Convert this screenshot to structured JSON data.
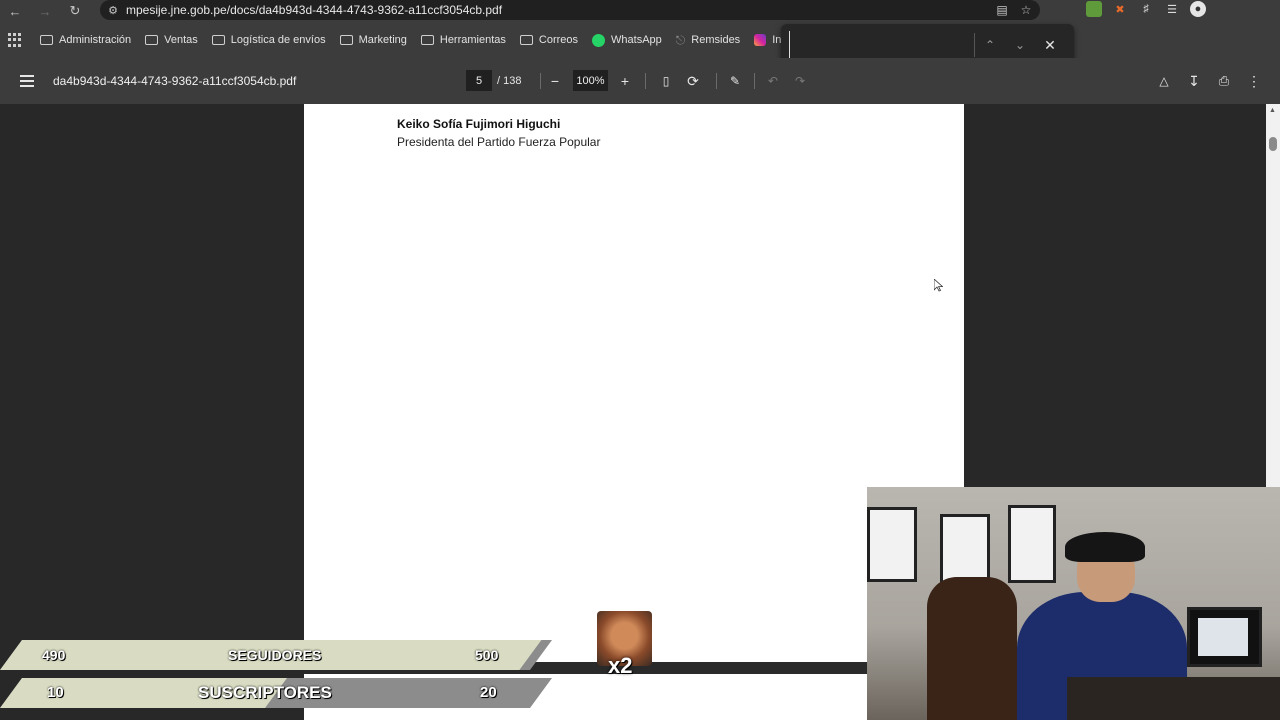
{
  "browser": {
    "url": "mpesije.jne.gob.pe/docs/da4b943d-4344-4743-9362-a11ccf3054cb.pdf",
    "bookmarks": [
      {
        "label": "Administración",
        "icon": "folder-icon"
      },
      {
        "label": "Ventas",
        "icon": "folder-icon"
      },
      {
        "label": "Logística de envíos",
        "icon": "folder-icon"
      },
      {
        "label": "Marketing",
        "icon": "folder-icon"
      },
      {
        "label": "Herramientas",
        "icon": "folder-icon"
      },
      {
        "label": "Correos",
        "icon": "folder-icon"
      },
      {
        "label": "WhatsApp",
        "icon": "whatsapp-icon"
      },
      {
        "label": "Remsides",
        "icon": "link-icon"
      },
      {
        "label": "Instagr",
        "icon": "instagram-icon"
      }
    ],
    "find": {
      "value": ""
    }
  },
  "pdf": {
    "title": "da4b943d-4344-4743-9362-a11ccf3054cb.pdf",
    "page_current": "5",
    "page_total": "/ 138",
    "zoom": "100%"
  },
  "document": {
    "signer_name": "Keiko Sofía Fujimori Higuchi",
    "signer_title": "Presidenta del Partido Fuerza Popular"
  },
  "overlay": {
    "followers": {
      "current": "490",
      "label": "SEGUIDORES",
      "goal": "500",
      "progress": 0.98
    },
    "subscribers": {
      "current": "10",
      "label": "SUSCRIPTORES",
      "goal": "20",
      "progress": 0.5
    },
    "emote_multiplier": "x2"
  },
  "colors": {
    "follow_fill": "#d9dcc2",
    "follow_track": "#8c8c8c",
    "subs_fill": "#d9dcc2",
    "subs_track": "#8c8c8c"
  }
}
